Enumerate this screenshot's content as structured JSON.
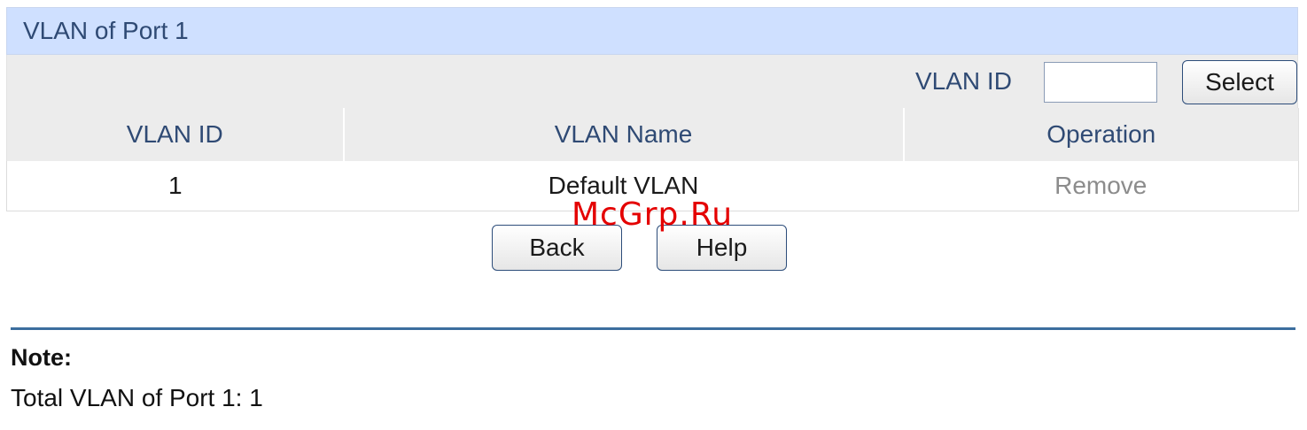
{
  "panel": {
    "title": "VLAN of Port 1"
  },
  "filter": {
    "label": "VLAN ID",
    "input_value": "",
    "select_label": "Select"
  },
  "table": {
    "columns": [
      "VLAN ID",
      "VLAN Name",
      "Operation"
    ],
    "rows": [
      {
        "vlan_id": "1",
        "vlan_name": "Default VLAN",
        "operation": "Remove"
      }
    ]
  },
  "actions": {
    "back_label": "Back",
    "help_label": "Help"
  },
  "watermark": "McGrp.Ru",
  "note": {
    "title": "Note:",
    "text": "Total VLAN of Port 1: 1"
  },
  "colors": {
    "title_bar": "#cfe0ff",
    "header_bg": "#ececec",
    "label_text": "#2f4a74",
    "disabled_link": "#8c8c8c",
    "rule": "#3c6e9e",
    "watermark": "#e40000"
  }
}
